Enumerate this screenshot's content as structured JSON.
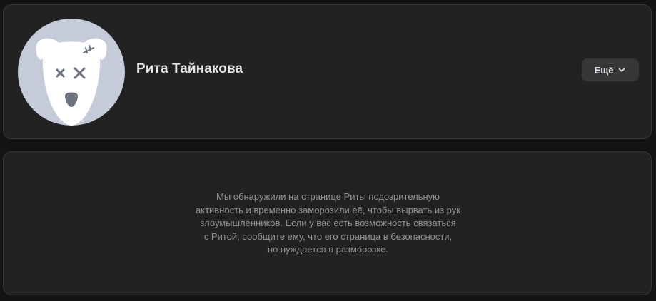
{
  "profile": {
    "name": "Рита Тайнакова",
    "avatar_icon": "frozen-dog-avatar-icon",
    "more_button": {
      "label": "Ещё",
      "icon": "chevron-down-icon"
    }
  },
  "notice": {
    "lines": [
      "Мы обнаружили на странице Риты подозрительную",
      "активность и временно заморозили её, чтобы вырвать из рук",
      "злоумышленников. Если у вас есть возможность связаться",
      "с Ритой, сообщите ему, что его страница в безопасности,",
      "но нуждается в разморозке."
    ]
  },
  "colors": {
    "page_background": "#141414",
    "card_background": "#222222",
    "card_border": "#363738",
    "avatar_background": "#c5cbd9",
    "avatar_dog": "#ffffff",
    "avatar_marks": "#6b7280",
    "name_text": "#e1e3e6",
    "notice_text": "#939393",
    "button_background": "#363738"
  }
}
